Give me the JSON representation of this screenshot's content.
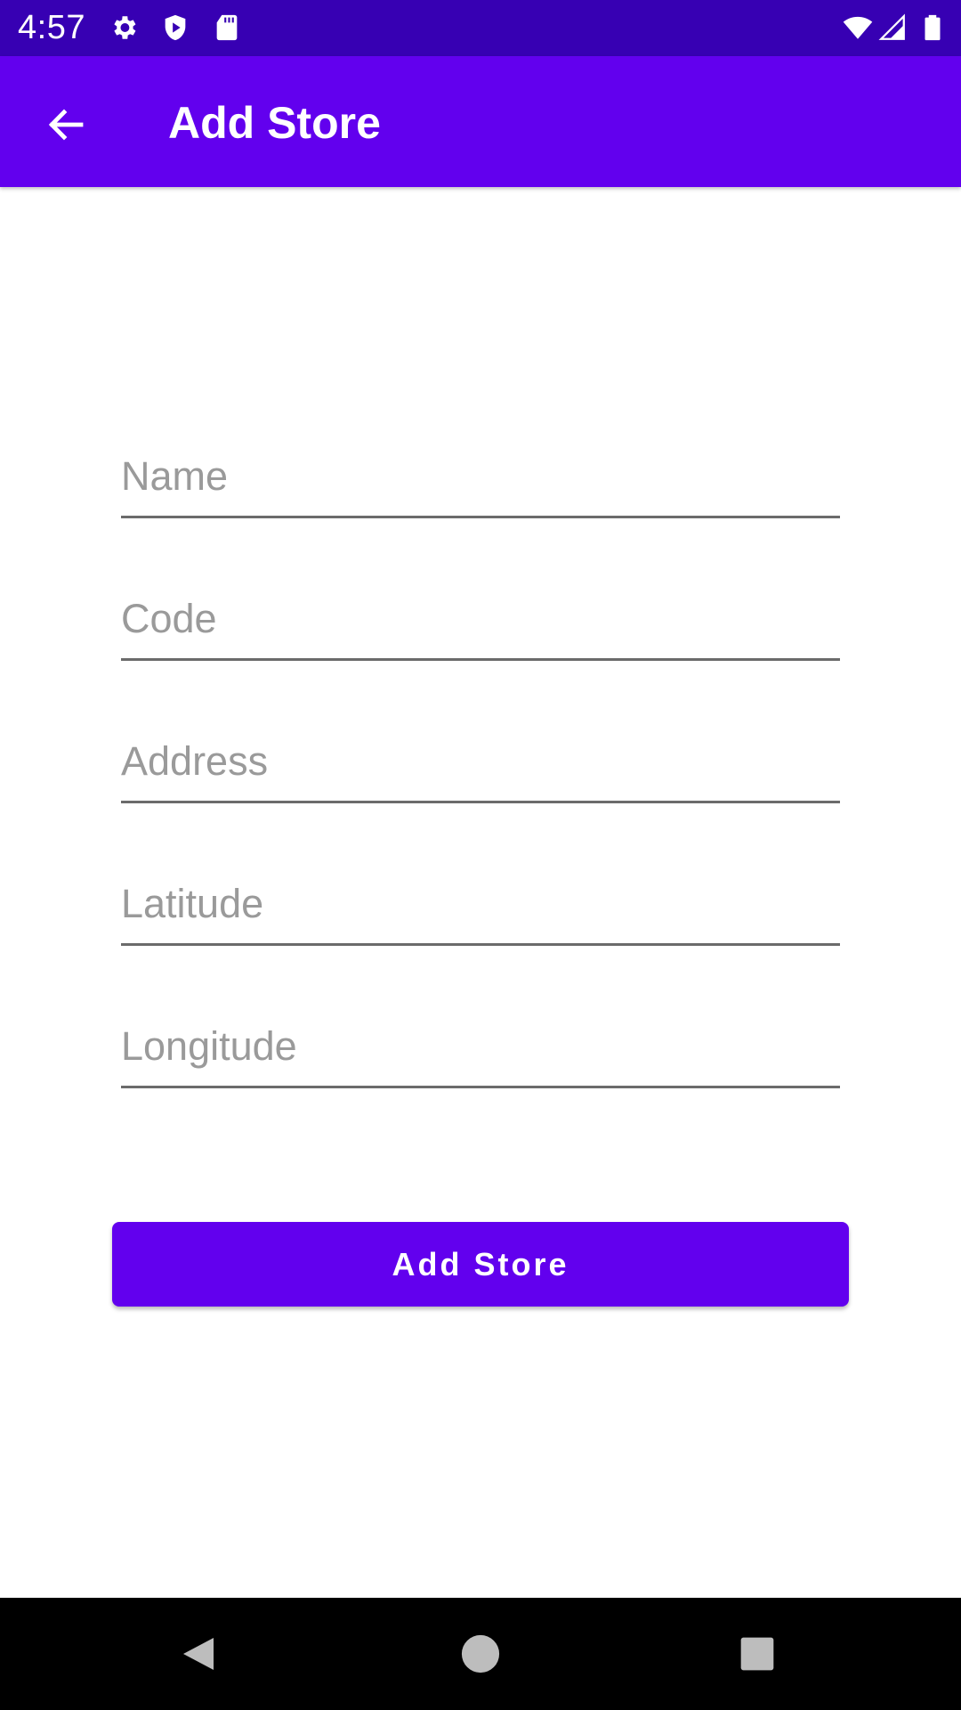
{
  "status_bar": {
    "time": "4:57",
    "left_icons": [
      "gear-icon",
      "shield-play-icon",
      "sd-card-icon"
    ],
    "right_icons": [
      "wifi-icon",
      "cell-signal-icon",
      "battery-icon"
    ],
    "background": "#3700b3"
  },
  "app_bar": {
    "title": "Add Store",
    "back_icon": "arrow-back-icon",
    "background": "#6200ee"
  },
  "form": {
    "fields": [
      {
        "placeholder": "Name",
        "value": ""
      },
      {
        "placeholder": "Code",
        "value": ""
      },
      {
        "placeholder": "Address",
        "value": ""
      },
      {
        "placeholder": "Latitude",
        "value": ""
      },
      {
        "placeholder": "Longitude",
        "value": ""
      }
    ],
    "submit_label": "Add Store",
    "accent": "#6200ee"
  },
  "nav_bar": {
    "buttons": [
      "back-triangle-icon",
      "home-circle-icon",
      "recents-square-icon"
    ]
  }
}
